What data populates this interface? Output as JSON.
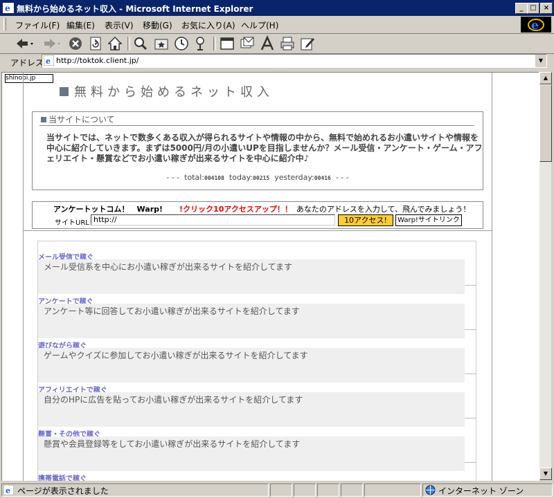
{
  "window": {
    "title": "無料から始めるネット収入 - Microsoft Internet Explorer"
  },
  "menu": [
    "ファイル(F)",
    "編集(E)",
    "表示(V)",
    "移動(G)",
    "お気に入り(A)",
    "ヘルプ(H)"
  ],
  "toolbar": {
    "icons": [
      "back-icon",
      "forward-icon",
      "stop-icon",
      "refresh-icon",
      "home-icon",
      "search-icon",
      "favorites-icon",
      "history-icon",
      "channels-icon",
      "fullscreen-icon",
      "mail-icon",
      "font-icon",
      "print-icon",
      "edit-icon"
    ]
  },
  "address": {
    "label": "アドレス",
    "url": "http://toktok.client.jp/"
  },
  "page": {
    "badge": "shinobi.jp",
    "site_title": "無料から始めるネット収入",
    "about_heading": "当サイトについて",
    "about_text": "当サイトでは、ネットで数多くある収入が得られるサイトや情報の中から、無料で始めれるお小遣いサイトや情報を中心に紹介していきます。まずは5000円/月の小遣いUPを目指しませんか？メール受信・アンケート・ゲーム・アフェリエイト・懸賞などでお小遣い稼ぎが出来るサイトを中心に紹介中♪",
    "counter": {
      "dashes": "- - -",
      "total_label": "total:",
      "total": "004108",
      "today_label": "today:",
      "today": "00215",
      "yesterday_label": "yesterday:",
      "yesterday": "00416"
    },
    "warp": {
      "brand": "アンケートットコム！　Warp!",
      "promo": "!クリック10アクセスアップ！！",
      "hint": "あなたのアドレスを入力して、飛んでみましょう！",
      "url_label": "サイトURL",
      "url_value": "http://",
      "btn_access": "10アクセス!",
      "btn_link": "Warp!サイトリンク"
    },
    "categories": [
      {
        "title": "メール受信で稼ぐ",
        "desc": "メール受信系を中心にお小遣い稼ぎが出来るサイトを紹介してます"
      },
      {
        "title": "アンケートで稼ぐ",
        "desc": "アンケート等に回答してお小遣い稼ぎが出来るサイトを紹介してます"
      },
      {
        "title": "遊びながら稼ぐ",
        "desc": "ゲームやクイズに参加してお小遣い稼ぎが出来るサイトを紹介してます"
      },
      {
        "title": "アフィリエイトで稼ぐ",
        "desc": "自分のHPに広告を貼ってお小遣い稼ぎが出来るサイトを紹介してます"
      },
      {
        "title": "懸賞・その他で稼ぐ",
        "desc": "懸賞や会員登録等をしてお小遣い稼ぎが出来るサイトを紹介してます"
      },
      {
        "title": "携帯電話で稼ぐ",
        "desc": ""
      }
    ]
  },
  "status": {
    "text": "ページが表示されました",
    "zone": "インターネット ゾーン"
  }
}
